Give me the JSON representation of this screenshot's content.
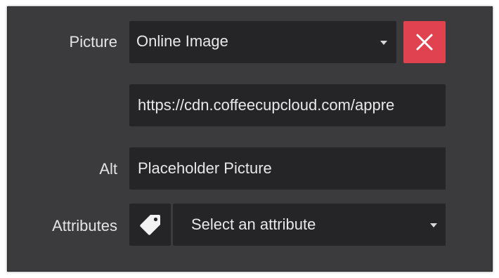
{
  "picture_field": {
    "label": "Picture",
    "source_select_value": "Online Image",
    "remove_button_icon": "close-icon"
  },
  "url_field": {
    "value": "https://cdn.coffeecupcloud.com/appre"
  },
  "alt_field": {
    "label": "Alt",
    "value": "Placeholder Picture"
  },
  "attributes_field": {
    "label": "Attributes",
    "icon": "tag-icon",
    "select_placeholder": "Select an attribute"
  },
  "colors": {
    "panel_bg": "#3b3b3d",
    "input_bg": "#252527",
    "danger": "#e0424f",
    "text": "#e8e8e8"
  }
}
